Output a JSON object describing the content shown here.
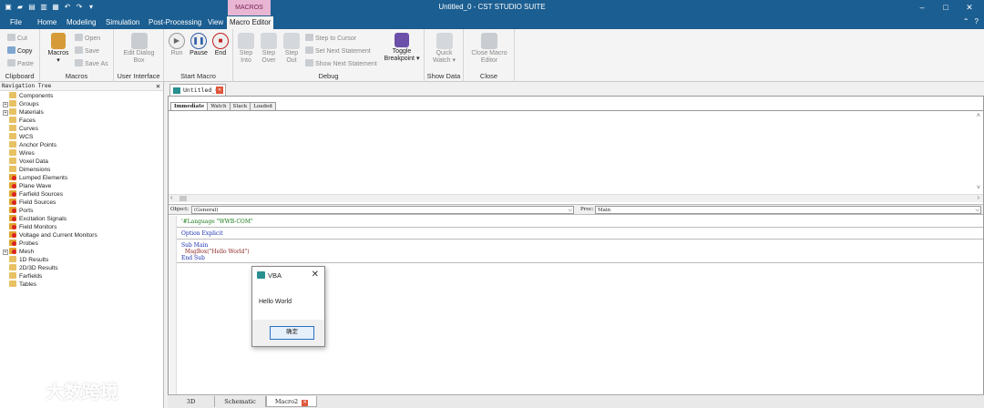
{
  "window": {
    "title": "Untitled_0 - CST STUDIO SUITE",
    "context_tab": "MACROS",
    "controls": [
      "–",
      "□",
      "✕"
    ]
  },
  "menubar": {
    "items": [
      "File",
      "Home",
      "Modeling",
      "Simulation",
      "Post-Processing",
      "View",
      "Macro Editor"
    ],
    "active": "Macro Editor",
    "right": [
      "⌃",
      "?"
    ]
  },
  "ribbon": {
    "clipboard": {
      "label": "Clipboard",
      "cut": "Cut",
      "copy": "Copy",
      "paste": "Paste"
    },
    "macros": {
      "label": "Macros",
      "macros_btn": "Macros",
      "open": "Open",
      "save": "Save",
      "save_as": "Save As"
    },
    "ui": {
      "label": "User Interface",
      "edit_dialog_l1": "Edit Dialog",
      "edit_dialog_l2": "Box"
    },
    "start": {
      "label": "Start Macro",
      "run": "Run",
      "pause": "Pause",
      "end": "End"
    },
    "debug": {
      "label": "Debug",
      "step_into_l1": "Step",
      "step_into_l2": "Into",
      "step_over_l1": "Step",
      "step_over_l2": "Over",
      "step_out_l1": "Step",
      "step_out_l2": "Out",
      "step_to_cursor": "Step to Cursor",
      "set_next": "Set Next Statement",
      "show_next": "Show Next Statement",
      "toggle_l1": "Toggle",
      "toggle_l2": "Breakpoint ▾"
    },
    "show_data": {
      "label": "Show Data",
      "quick_l1": "Quick",
      "quick_l2": "Watch ▾"
    },
    "close": {
      "label": "Close",
      "close_l1": "Close Macro",
      "close_l2": "Editor"
    }
  },
  "nav": {
    "title": "Navigation Tree",
    "close": "✕",
    "items": [
      {
        "label": "Components",
        "expand": false,
        "icon": "plain"
      },
      {
        "label": "Groups",
        "expand": true,
        "icon": "plain"
      },
      {
        "label": "Materials",
        "expand": true,
        "icon": "plain"
      },
      {
        "label": "Faces",
        "expand": false,
        "icon": "plain"
      },
      {
        "label": "Curves",
        "expand": false,
        "icon": "plain"
      },
      {
        "label": "WCS",
        "expand": false,
        "icon": "plain"
      },
      {
        "label": "Anchor Points",
        "expand": false,
        "icon": "plain"
      },
      {
        "label": "Wires",
        "expand": false,
        "icon": "plain"
      },
      {
        "label": "Voxel Data",
        "expand": false,
        "icon": "plain"
      },
      {
        "label": "Dimensions",
        "expand": false,
        "icon": "plain"
      },
      {
        "label": "Lumped Elements",
        "expand": false,
        "icon": "red"
      },
      {
        "label": "Plane Wave",
        "expand": false,
        "icon": "red"
      },
      {
        "label": "Farfield Sources",
        "expand": false,
        "icon": "red"
      },
      {
        "label": "Field Sources",
        "expand": false,
        "icon": "red"
      },
      {
        "label": "Ports",
        "expand": false,
        "icon": "red"
      },
      {
        "label": "Excitation Signals",
        "expand": false,
        "icon": "red"
      },
      {
        "label": "Field Monitors",
        "expand": false,
        "icon": "red"
      },
      {
        "label": "Voltage and Current Monitors",
        "expand": false,
        "icon": "red"
      },
      {
        "label": "Probes",
        "expand": false,
        "icon": "red"
      },
      {
        "label": "Mesh",
        "expand": true,
        "icon": "red"
      },
      {
        "label": "1D Results",
        "expand": false,
        "icon": "plain"
      },
      {
        "label": "2D/3D Results",
        "expand": false,
        "icon": "plain"
      },
      {
        "label": "Farfields",
        "expand": false,
        "icon": "plain"
      },
      {
        "label": "Tables",
        "expand": false,
        "icon": "plain"
      }
    ]
  },
  "editor": {
    "doc_tab": "Untitled_0*",
    "debug_tabs": [
      "Immediate",
      "Watch",
      "Stack",
      "Loaded"
    ],
    "object_label": "Object:",
    "object_value": "(General)",
    "proc_label": "Proc:",
    "proc_value": "Main",
    "code": {
      "line1": "'#Language \"WWB-COM\"",
      "line2_kw": "Option Explicit",
      "line3": "Sub Main",
      "line4": "  MsgBox(\"Hello World\")",
      "line5": "End Sub"
    }
  },
  "bottom_tabs": [
    "3D",
    "Schematic",
    "Macro2"
  ],
  "dialog": {
    "title": "VBA",
    "message": "Hello World",
    "ok": "确定",
    "close": "✕"
  },
  "watermark": "大数跨境",
  "colors": {
    "titlebar": "#1b5e91",
    "context_tab": "#e8b6d3",
    "ok_border": "#2a6fc9"
  }
}
